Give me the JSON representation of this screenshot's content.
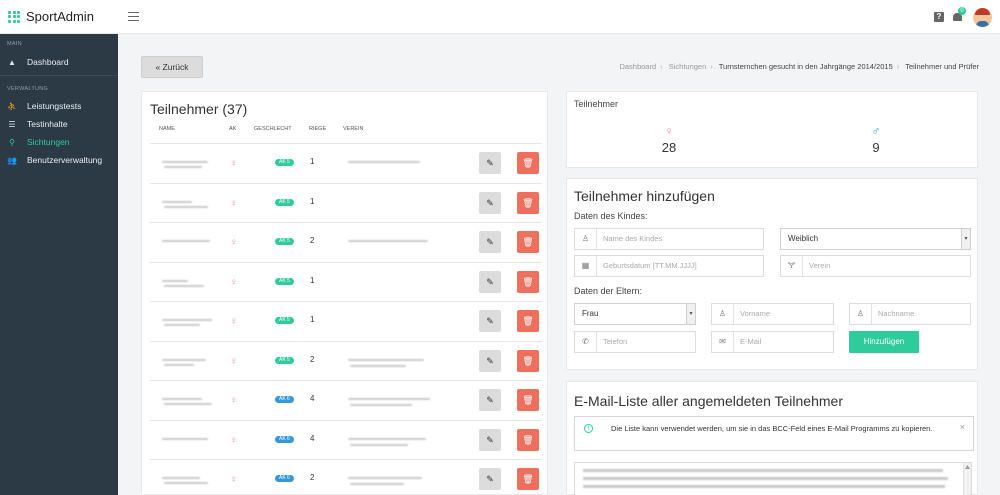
{
  "app": {
    "name": "SportAdmin",
    "badge_count": "0"
  },
  "sidebar": {
    "sections": [
      {
        "label": "MAIN",
        "items": [
          {
            "label": "Dashboard",
            "icon": "mountain-icon",
            "active": false
          }
        ]
      },
      {
        "label": "VERWALTUNG",
        "items": [
          {
            "label": "Leistungstests",
            "icon": "runner-icon",
            "active": false
          },
          {
            "label": "Testinhalte",
            "icon": "list-icon",
            "active": false
          },
          {
            "label": "Sichtungen",
            "icon": "search-icon",
            "active": true
          },
          {
            "label": "Benutzerverwaltung",
            "icon": "users-icon",
            "active": false
          }
        ]
      }
    ]
  },
  "back_button": "« Zurück",
  "breadcrumb": [
    "Dashboard",
    "Sichtungen",
    "Turnsternchen gesucht in den Jahrgänge 2014/2015",
    "Teilnehmer und Prüfer"
  ],
  "participants": {
    "title": "Teilnehmer (37)",
    "columns": [
      "NAME",
      "AK",
      "GESCHLECHT",
      "RIEGE",
      "VEREIN"
    ],
    "rows": [
      {
        "ak": "AK 5",
        "ak_color": "#2ecc9a",
        "riege": "1",
        "verein": true
      },
      {
        "ak": "AK 5",
        "ak_color": "#2ecc9a",
        "riege": "1",
        "verein": false
      },
      {
        "ak": "AK 5",
        "ak_color": "#2ecc9a",
        "riege": "2",
        "verein": true
      },
      {
        "ak": "AK 5",
        "ak_color": "#2ecc9a",
        "riege": "1",
        "verein": false
      },
      {
        "ak": "AK 5",
        "ak_color": "#2ecc9a",
        "riege": "1",
        "verein": false
      },
      {
        "ak": "AK 5",
        "ak_color": "#2ecc9a",
        "riege": "2",
        "verein": true
      },
      {
        "ak": "AK 6",
        "ak_color": "#3598db",
        "riege": "4",
        "verein": true
      },
      {
        "ak": "AK 6",
        "ak_color": "#3598db",
        "riege": "4",
        "verein": true
      },
      {
        "ak": "AK 6",
        "ak_color": "#3598db",
        "riege": "2",
        "verein": true
      }
    ]
  },
  "stats": {
    "label": "Teilnehmer",
    "female": "28",
    "male": "9",
    "female_color": "#f58aae",
    "male_color": "#3598db"
  },
  "add_form": {
    "title": "Teilnehmer hinzufügen",
    "child_label": "Daten des Kindes:",
    "child_name_placeholder": "Name des Kindes",
    "gender_value": "Weiblich",
    "birthdate_placeholder": "Geburtsdatum [TT.MM.JJJJ]",
    "club_placeholder": "Verein",
    "parents_label": "Daten der Eltern:",
    "salutation_value": "Frau",
    "firstname_placeholder": "Vorname",
    "lastname_placeholder": "Nachname",
    "phone_placeholder": "Telefon",
    "email_placeholder": "E-Mail",
    "submit_label": "Hinzufügen"
  },
  "mail_list": {
    "title": "E-Mail-Liste aller angemeldeten Teilnehmer",
    "info_text": "Die Liste kann verwendet werden, um sie in das BCC-Feld eines E-Mail Programms zu kopieren.",
    "close": "×"
  }
}
